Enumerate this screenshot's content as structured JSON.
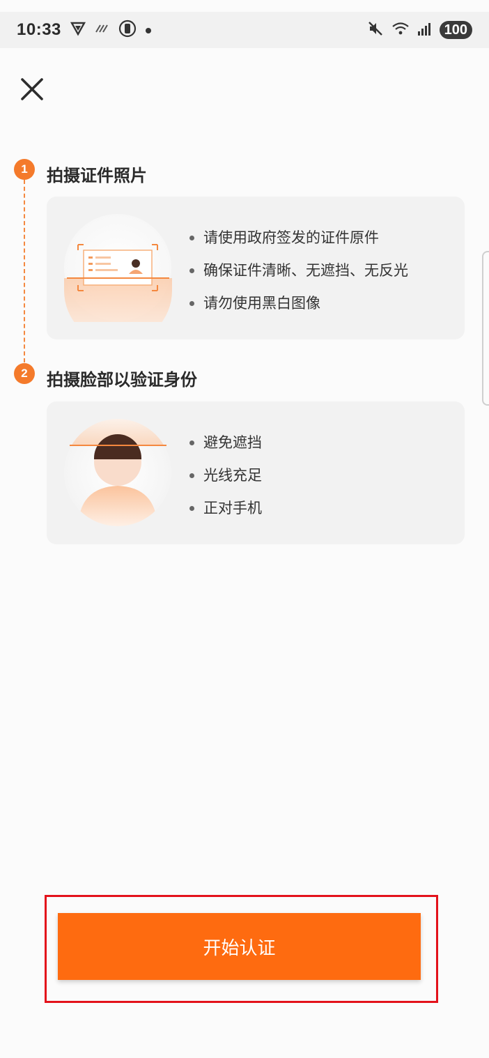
{
  "status_bar": {
    "time": "10:33",
    "battery": "100",
    "icons": [
      "vpn-icon",
      "data-icon",
      "app-icon",
      "dot-icon",
      "mute-icon",
      "wifi-icon",
      "signal-icon"
    ]
  },
  "close_icon": "close-icon",
  "steps": [
    {
      "number": "1",
      "title": "拍摄证件照片",
      "tips": [
        "请使用政府签发的证件原件",
        "确保证件清晰、无遮挡、无反光",
        "请勿使用黑白图像"
      ],
      "illustration": "id-card-illustration"
    },
    {
      "number": "2",
      "title": "拍摄脸部以验证身份",
      "tips": [
        "避免遮挡",
        "光线充足",
        "正对手机"
      ],
      "illustration": "face-illustration"
    }
  ],
  "start_button": {
    "label": "开始认证"
  },
  "colors": {
    "accent": "#fe6b10",
    "step_badge": "#f47a2b",
    "highlight": "#e3121b",
    "card_bg": "#f2f2f2"
  }
}
